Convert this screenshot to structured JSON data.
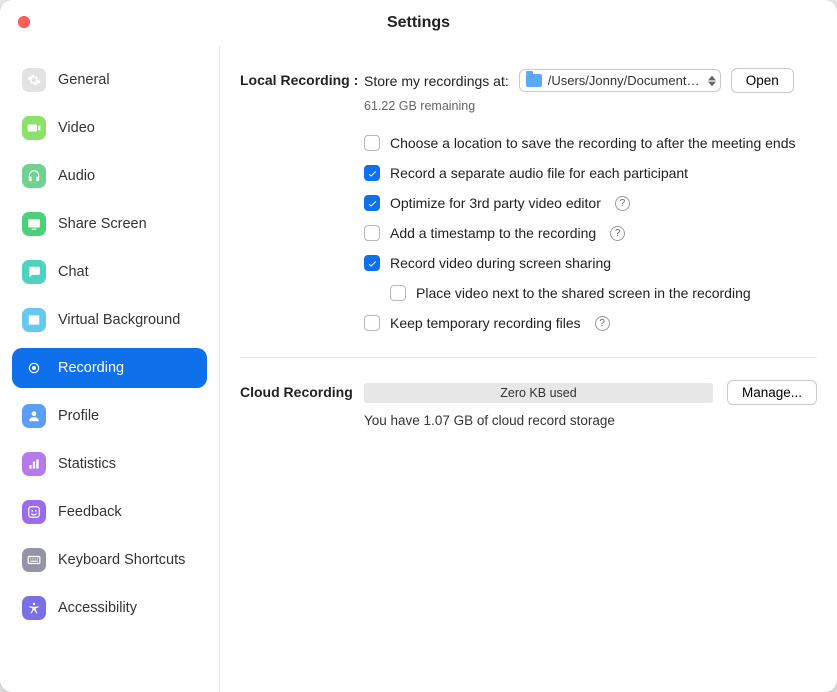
{
  "window": {
    "title": "Settings"
  },
  "sidebar": {
    "items": [
      {
        "key": "general",
        "label": "General",
        "bg": "#e2e2e2",
        "icon": "gear"
      },
      {
        "key": "video",
        "label": "Video",
        "bg": "#8de06a",
        "icon": "video"
      },
      {
        "key": "audio",
        "label": "Audio",
        "bg": "#6fd290",
        "icon": "headphones"
      },
      {
        "key": "share",
        "label": "Share Screen",
        "bg": "#4dd07a",
        "icon": "screen"
      },
      {
        "key": "chat",
        "label": "Chat",
        "bg": "#4fd2c0",
        "icon": "chat"
      },
      {
        "key": "vbg",
        "label": "Virtual Background",
        "bg": "#66c8ed",
        "icon": "person"
      },
      {
        "key": "recording",
        "label": "Recording",
        "active": true,
        "bg": "#ffffff",
        "icon": "record"
      },
      {
        "key": "profile",
        "label": "Profile",
        "bg": "#5b9ff5",
        "icon": "profile"
      },
      {
        "key": "statistics",
        "label": "Statistics",
        "bg": "#b57bea",
        "icon": "bars"
      },
      {
        "key": "feedback",
        "label": "Feedback",
        "bg": "#9a6bea",
        "icon": "face"
      },
      {
        "key": "shortcuts",
        "label": "Keyboard Shortcuts",
        "bg": "#9494a6",
        "icon": "keyboard"
      },
      {
        "key": "accessibility",
        "label": "Accessibility",
        "bg": "#7b6fe6",
        "icon": "a11y"
      }
    ]
  },
  "local": {
    "section_label": "Local Recording :",
    "store_label": "Store my recordings at:",
    "path": "/Users/Jonny/Documents/…",
    "open_button": "Open",
    "remaining": "61.22 GB remaining",
    "options": [
      {
        "key": "choose_loc",
        "checked": false,
        "label": "Choose a location to save the recording to after the meeting ends"
      },
      {
        "key": "sep_audio",
        "checked": true,
        "label": "Record a separate audio file for each participant"
      },
      {
        "key": "optimize",
        "checked": true,
        "label": "Optimize for 3rd party video editor",
        "help": true
      },
      {
        "key": "timestamp",
        "checked": false,
        "label": "Add a timestamp to the recording",
        "help": true
      },
      {
        "key": "rec_screen",
        "checked": true,
        "label": "Record video during screen sharing"
      },
      {
        "key": "place_next",
        "checked": false,
        "label": "Place video next to the shared screen in the recording",
        "indent": true
      },
      {
        "key": "keep_temp",
        "checked": false,
        "label": "Keep temporary recording files",
        "help": true
      }
    ]
  },
  "cloud": {
    "section_label": "Cloud Recording",
    "usage_text": "Zero KB used",
    "manage_button": "Manage...",
    "storage_text": "You have 1.07 GB of cloud record storage"
  }
}
